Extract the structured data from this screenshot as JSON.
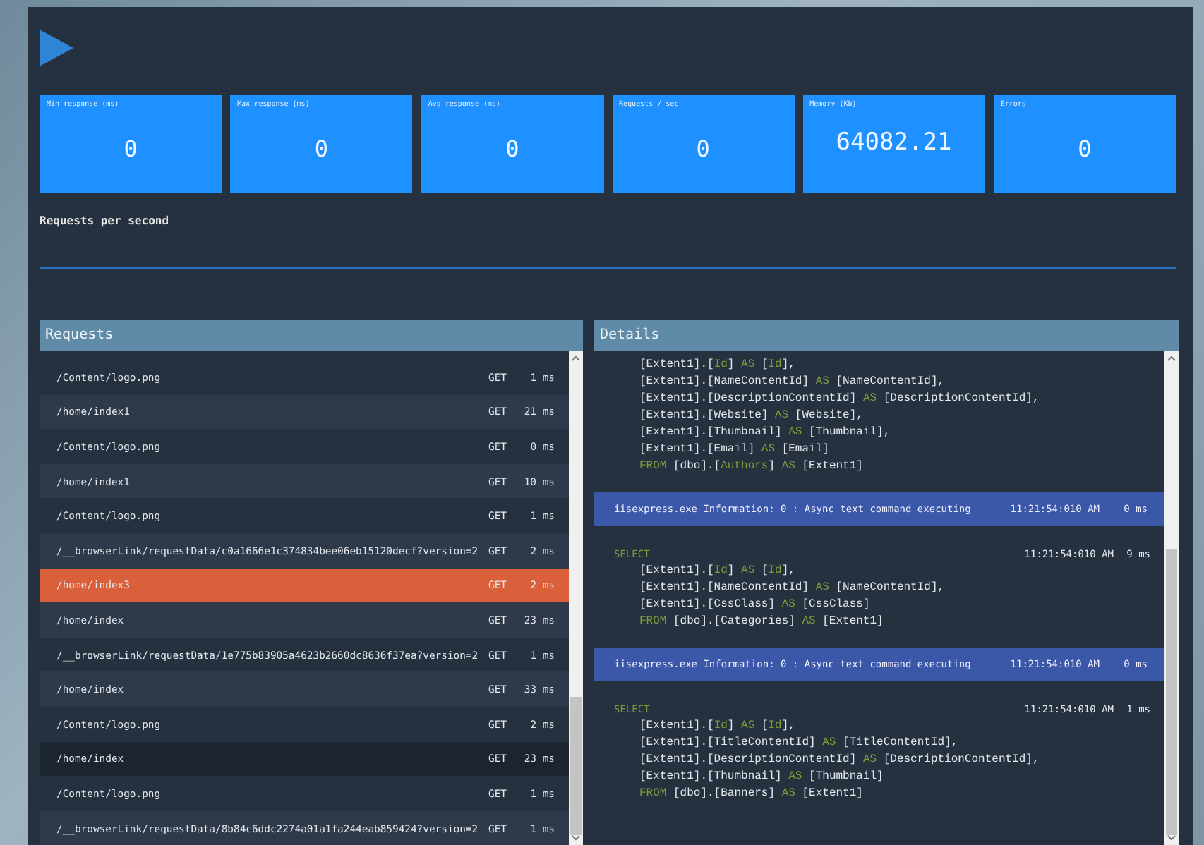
{
  "tiles": [
    {
      "label": "Min response (ms)",
      "value": "0"
    },
    {
      "label": "Max response (ms)",
      "value": "0"
    },
    {
      "label": "Avg response (ms)",
      "value": "0"
    },
    {
      "label": "Requests / sec",
      "value": "0"
    },
    {
      "label": "Memory (Kb)",
      "value": "64082.21"
    },
    {
      "label": "Errors",
      "value": "0"
    }
  ],
  "chart": {
    "title": "Requests per second"
  },
  "requests": {
    "title": "Requests",
    "rows": [
      {
        "path": "/Content/logo.png",
        "method": "GET",
        "time": "1 ms",
        "selected": false,
        "hovered": false
      },
      {
        "path": "/home/index1",
        "method": "GET",
        "time": "21 ms",
        "selected": false,
        "hovered": false
      },
      {
        "path": "/Content/logo.png",
        "method": "GET",
        "time": "0 ms",
        "selected": false,
        "hovered": false
      },
      {
        "path": "/home/index1",
        "method": "GET",
        "time": "10 ms",
        "selected": false,
        "hovered": false
      },
      {
        "path": "/Content/logo.png",
        "method": "GET",
        "time": "1 ms",
        "selected": false,
        "hovered": false
      },
      {
        "path": "/__browserLink/requestData/c0a1666e1c374834bee06eb15120decf?version=2",
        "method": "GET",
        "time": "2 ms",
        "selected": false,
        "hovered": false
      },
      {
        "path": "/home/index3",
        "method": "GET",
        "time": "2 ms",
        "selected": true,
        "hovered": false
      },
      {
        "path": "/home/index",
        "method": "GET",
        "time": "23 ms",
        "selected": false,
        "hovered": false
      },
      {
        "path": "/__browserLink/requestData/1e775b83905a4623b2660dc8636f37ea?version=2",
        "method": "GET",
        "time": "1 ms",
        "selected": false,
        "hovered": false
      },
      {
        "path": "/home/index",
        "method": "GET",
        "time": "33 ms",
        "selected": false,
        "hovered": false
      },
      {
        "path": "/Content/logo.png",
        "method": "GET",
        "time": "2 ms",
        "selected": false,
        "hovered": false
      },
      {
        "path": "/home/index",
        "method": "GET",
        "time": "23 ms",
        "selected": false,
        "hovered": true
      },
      {
        "path": "/Content/logo.png",
        "method": "GET",
        "time": "1 ms",
        "selected": false,
        "hovered": false
      },
      {
        "path": "/__browserLink/requestData/8b84c6ddc2274a01a1fa244eab859424?version=2",
        "method": "GET",
        "time": "1 ms",
        "selected": false,
        "hovered": false
      }
    ]
  },
  "details": {
    "title": "Details",
    "entries": [
      {
        "kind": "sql",
        "lines": [
          [
            {
              "text": "[Extent1].[",
              "kind": "plain"
            },
            {
              "text": "Id",
              "kind": "kw"
            },
            {
              "text": "] ",
              "kind": "plain"
            },
            {
              "text": "AS",
              "kind": "kw"
            },
            {
              "text": " [",
              "kind": "plain"
            },
            {
              "text": "Id",
              "kind": "kw"
            },
            {
              "text": "],",
              "kind": "plain"
            }
          ],
          [
            {
              "text": "[Extent1].[NameContentId] ",
              "kind": "plain"
            },
            {
              "text": "AS",
              "kind": "kw"
            },
            {
              "text": " [NameContentId],",
              "kind": "plain"
            }
          ],
          [
            {
              "text": "[Extent1].[DescriptionContentId] ",
              "kind": "plain"
            },
            {
              "text": "AS",
              "kind": "kw"
            },
            {
              "text": " [DescriptionContentId],",
              "kind": "plain"
            }
          ],
          [
            {
              "text": "[Extent1].[Website] ",
              "kind": "plain"
            },
            {
              "text": "AS",
              "kind": "kw"
            },
            {
              "text": " [Website],",
              "kind": "plain"
            }
          ],
          [
            {
              "text": "[Extent1].[Thumbnail] ",
              "kind": "plain"
            },
            {
              "text": "AS",
              "kind": "kw"
            },
            {
              "text": " [Thumbnail],",
              "kind": "plain"
            }
          ],
          [
            {
              "text": "[Extent1].[Email] ",
              "kind": "plain"
            },
            {
              "text": "AS",
              "kind": "kw"
            },
            {
              "text": " [Email]",
              "kind": "plain"
            }
          ],
          [
            {
              "text": "FROM",
              "kind": "kw"
            },
            {
              "text": " [dbo].[",
              "kind": "plain"
            },
            {
              "text": "Authors",
              "kind": "kw"
            },
            {
              "text": "] ",
              "kind": "plain"
            },
            {
              "text": "AS",
              "kind": "kw"
            },
            {
              "text": " [Extent1]",
              "kind": "plain"
            }
          ]
        ]
      },
      {
        "kind": "info",
        "text": "iisexpress.exe Information: 0 : Async text command executing",
        "time": "11:21:54:010 AM",
        "duration": "0 ms"
      },
      {
        "kind": "sql",
        "head": "SELECT",
        "time": "11:21:54:010 AM",
        "duration": "9 ms",
        "lines": [
          [
            {
              "text": "[Extent1].[",
              "kind": "plain"
            },
            {
              "text": "Id",
              "kind": "kw"
            },
            {
              "text": "] ",
              "kind": "plain"
            },
            {
              "text": "AS",
              "kind": "kw"
            },
            {
              "text": " [",
              "kind": "plain"
            },
            {
              "text": "Id",
              "kind": "kw"
            },
            {
              "text": "],",
              "kind": "plain"
            }
          ],
          [
            {
              "text": "[Extent1].[NameContentId] ",
              "kind": "plain"
            },
            {
              "text": "AS",
              "kind": "kw"
            },
            {
              "text": " [NameContentId],",
              "kind": "plain"
            }
          ],
          [
            {
              "text": "[Extent1].[CssClass] ",
              "kind": "plain"
            },
            {
              "text": "AS",
              "kind": "kw"
            },
            {
              "text": " [CssClass]",
              "kind": "plain"
            }
          ],
          [
            {
              "text": "FROM",
              "kind": "kw"
            },
            {
              "text": " [dbo].[Categories] ",
              "kind": "plain"
            },
            {
              "text": "AS",
              "kind": "kw"
            },
            {
              "text": " [Extent1]",
              "kind": "plain"
            }
          ]
        ]
      },
      {
        "kind": "info",
        "text": "iisexpress.exe Information: 0 : Async text command executing",
        "time": "11:21:54:010 AM",
        "duration": "0 ms"
      },
      {
        "kind": "sql",
        "head": "SELECT",
        "time": "11:21:54:010 AM",
        "duration": "1 ms",
        "lines": [
          [
            {
              "text": "[Extent1].[",
              "kind": "plain"
            },
            {
              "text": "Id",
              "kind": "kw"
            },
            {
              "text": "] ",
              "kind": "plain"
            },
            {
              "text": "AS",
              "kind": "kw"
            },
            {
              "text": " [",
              "kind": "plain"
            },
            {
              "text": "Id",
              "kind": "kw"
            },
            {
              "text": "],",
              "kind": "plain"
            }
          ],
          [
            {
              "text": "[Extent1].[TitleContentId] ",
              "kind": "plain"
            },
            {
              "text": "AS",
              "kind": "kw"
            },
            {
              "text": " [TitleContentId],",
              "kind": "plain"
            }
          ],
          [
            {
              "text": "[Extent1].[DescriptionContentId] ",
              "kind": "plain"
            },
            {
              "text": "AS",
              "kind": "kw"
            },
            {
              "text": " [DescriptionContentId],",
              "kind": "plain"
            }
          ],
          [
            {
              "text": "[Extent1].[Thumbnail] ",
              "kind": "plain"
            },
            {
              "text": "AS",
              "kind": "kw"
            },
            {
              "text": " [Thumbnail]",
              "kind": "plain"
            }
          ],
          [
            {
              "text": "FROM",
              "kind": "kw"
            },
            {
              "text": " [dbo].[Banners] ",
              "kind": "plain"
            },
            {
              "text": "AS",
              "kind": "kw"
            },
            {
              "text": " [Extent1]",
              "kind": "plain"
            }
          ]
        ]
      }
    ]
  }
}
